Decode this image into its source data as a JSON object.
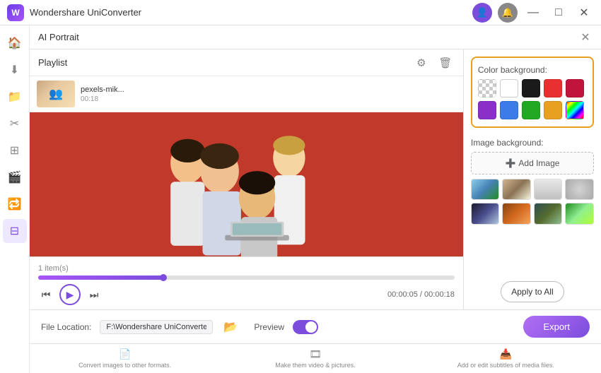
{
  "titleBar": {
    "appName": "Wondershare UniConverter",
    "controls": {
      "minimize": "—",
      "maximize": "□",
      "close": "✕"
    }
  },
  "aiPortrait": {
    "panelTitle": "AI Portrait"
  },
  "playlist": {
    "title": "Playlist",
    "items": [
      {
        "name": "pexels-mik...",
        "duration": "00:18"
      }
    ],
    "itemCount": "1 item(s)"
  },
  "videoPlayer": {
    "currentTime": "00:00:05",
    "totalTime": "00:00:18"
  },
  "colorBackground": {
    "label": "Color background:",
    "colors": [
      {
        "id": "checker",
        "value": "checker"
      },
      {
        "id": "white",
        "value": "#ffffff"
      },
      {
        "id": "black",
        "value": "#1a1a1a"
      },
      {
        "id": "red",
        "value": "#e83030"
      },
      {
        "id": "darkred",
        "value": "#c0143c"
      },
      {
        "id": "purple",
        "value": "#8b2fc9"
      },
      {
        "id": "blue",
        "value": "#3c7be8"
      },
      {
        "id": "green",
        "value": "#22a822"
      },
      {
        "id": "orange",
        "value": "#e8a020"
      },
      {
        "id": "rainbow",
        "value": "rainbow"
      }
    ]
  },
  "imageBackground": {
    "label": "Image background:",
    "addButtonLabel": "Add Image",
    "thumbnails": [
      {
        "id": 1,
        "class": "bg-thumb-1"
      },
      {
        "id": 2,
        "class": "bg-thumb-2"
      },
      {
        "id": 3,
        "class": "bg-thumb-3"
      },
      {
        "id": 4,
        "class": "bg-thumb-4"
      },
      {
        "id": 5,
        "class": "bg-thumb-5"
      },
      {
        "id": 6,
        "class": "bg-thumb-6"
      },
      {
        "id": 7,
        "class": "bg-thumb-7"
      },
      {
        "id": 8,
        "class": "bg-thumb-8"
      }
    ]
  },
  "applyButton": {
    "label": "Apply to All"
  },
  "bottomBar": {
    "fileLocationLabel": "File Location:",
    "fileLocationValue": "F:\\Wondershare UniConverter",
    "previewLabel": "Preview",
    "exportLabel": "Export"
  },
  "bottomNav": [
    {
      "icon": "📄",
      "label": "Convert images to other formats."
    },
    {
      "icon": "🔗",
      "label": "Make them video & pictures."
    },
    {
      "icon": "📥",
      "label": "Add or edit subtitles of media files."
    }
  ],
  "sidebar": {
    "icons": [
      "🏠",
      "⬇",
      "📁",
      "✂",
      "⊞",
      "🎬",
      "🔄",
      "⊞"
    ]
  }
}
